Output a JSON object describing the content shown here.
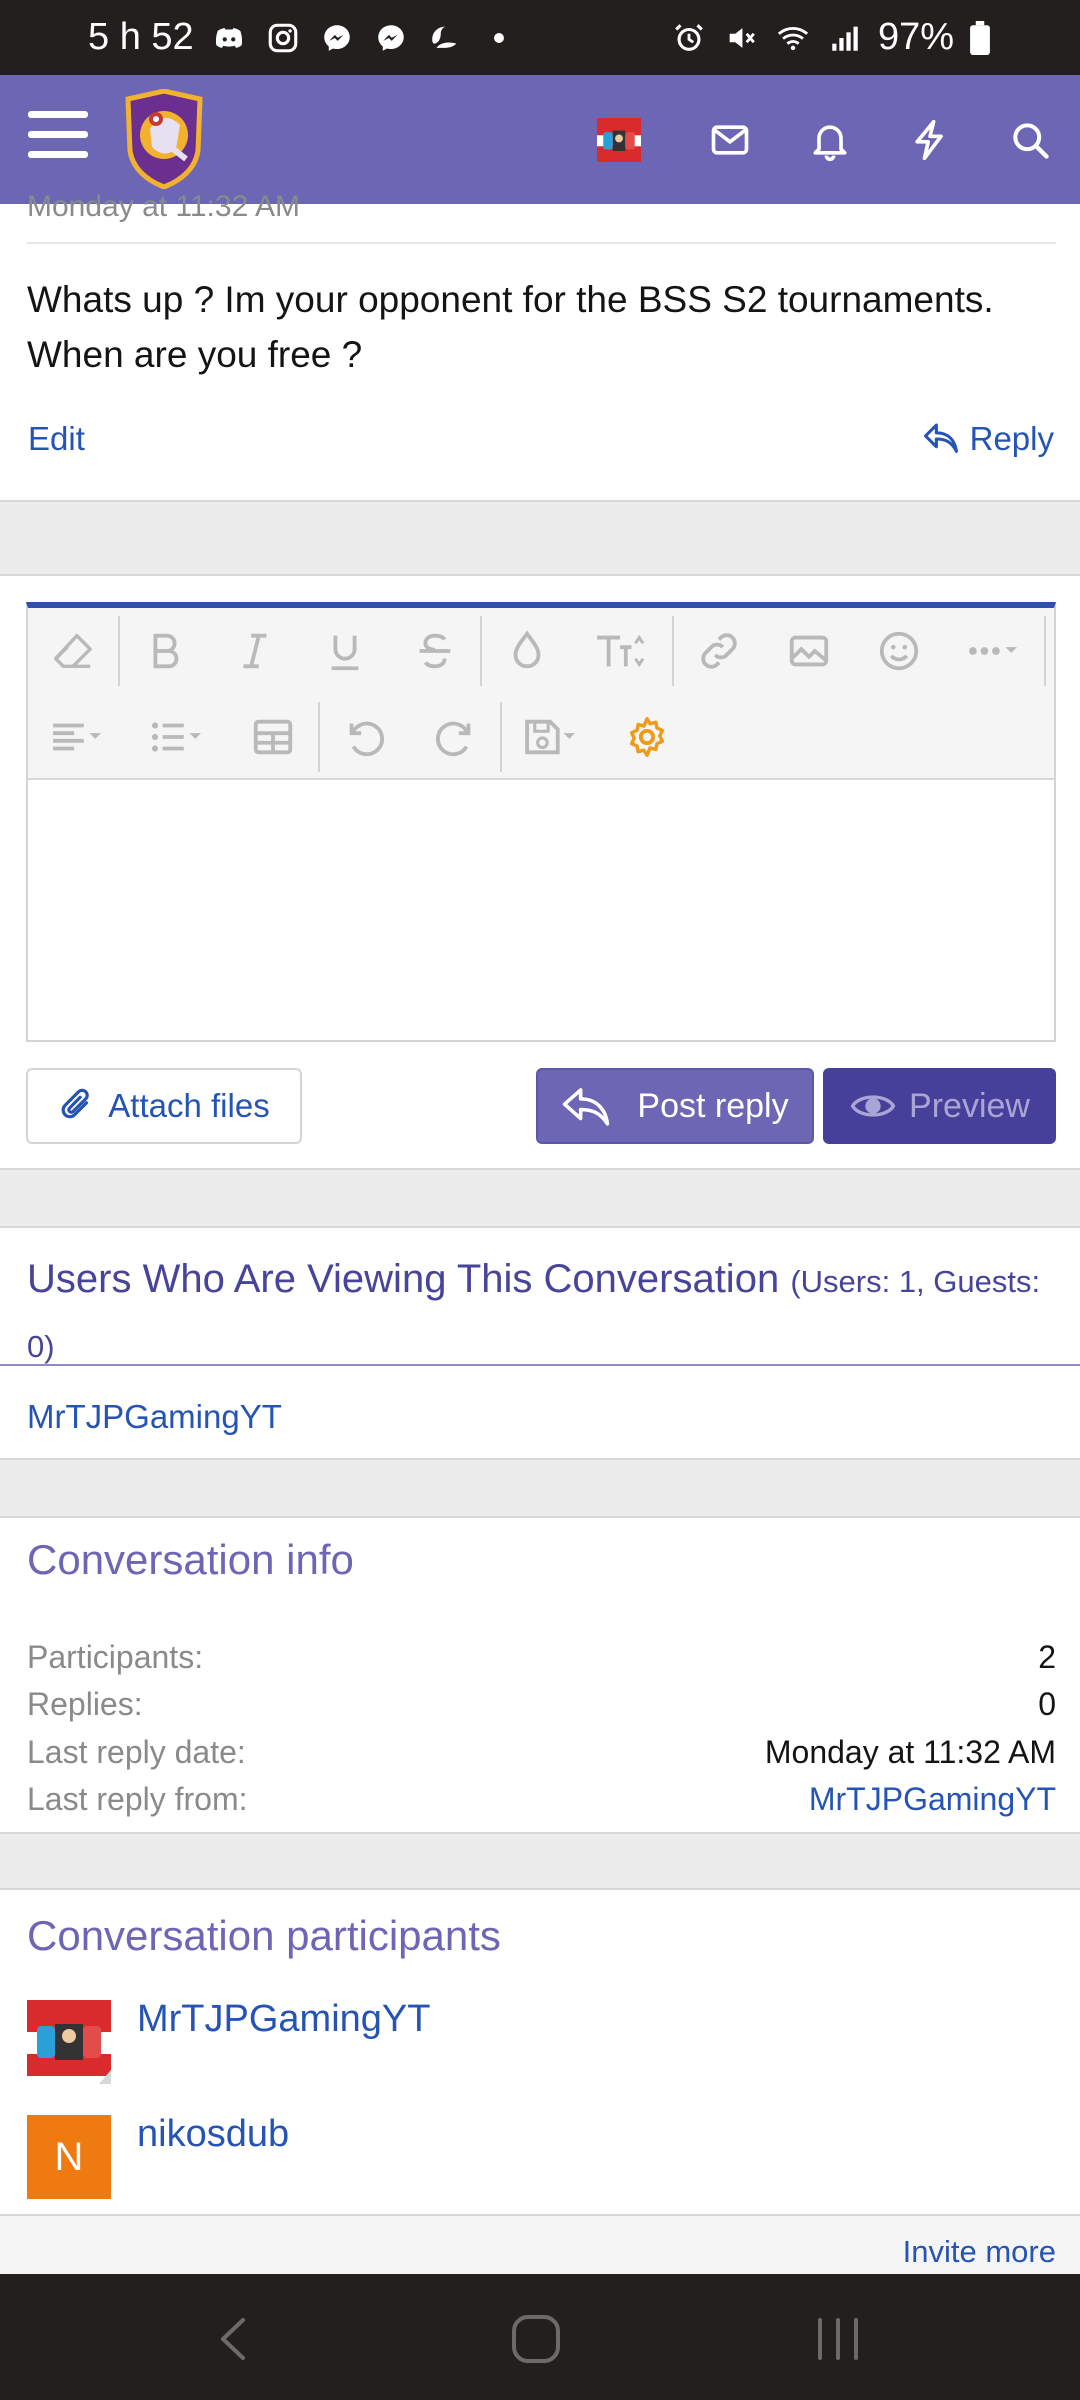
{
  "status_bar": {
    "time": "5 h 52",
    "battery": "97%",
    "left_icons": [
      "discord-icon",
      "instagram-icon",
      "messenger-icon",
      "messenger-icon",
      "sleep-icon",
      "dot-icon"
    ],
    "right_icons": [
      "alarm-icon",
      "mute-icon",
      "wifi-icon",
      "signal-icon",
      "battery-icon"
    ]
  },
  "app_bar": {
    "icons": [
      "menu-icon",
      "site-logo",
      "user-avatar",
      "inbox-icon",
      "bell-icon",
      "bolt-icon",
      "search-icon"
    ],
    "color": "#6c66b5"
  },
  "message": {
    "date": "Monday at 11:32 AM",
    "body": "Whats up ? Im your opponent for the BSS S2 tournaments. When are you free ?",
    "edit_label": "Edit",
    "reply_label": "Reply"
  },
  "editor": {
    "toolbar_row1": [
      "eraser-icon",
      "bold-icon",
      "italic-icon",
      "underline-icon",
      "strikethrough-icon",
      "color-drop-icon",
      "text-size-icon",
      "link-icon",
      "image-icon",
      "smiley-icon",
      "more-icon"
    ],
    "toolbar_row2": [
      "align-icon",
      "list-icon",
      "table-icon",
      "undo-icon",
      "redo-icon",
      "save-draft-icon",
      "settings-gear-icon"
    ],
    "attach_label": "Attach files",
    "post_label": "Post reply",
    "preview_label": "Preview"
  },
  "viewers": {
    "title": "Users Who Are Viewing This Conversation",
    "count": "(Users: 1, Guests: 0)",
    "users": [
      "MrTJPGamingYT"
    ]
  },
  "conversation_info": {
    "title": "Conversation info",
    "rows": [
      {
        "label": "Participants:",
        "value": "2"
      },
      {
        "label": "Replies:",
        "value": "0"
      },
      {
        "label": "Last reply date:",
        "value": "Monday at 11:32 AM"
      },
      {
        "label": "Last reply from:",
        "value": "MrTJPGamingYT"
      }
    ]
  },
  "participants": {
    "title": "Conversation participants",
    "list": [
      {
        "name": "MrTJPGamingYT",
        "avatar": "image"
      },
      {
        "name": "nikosdub",
        "avatar_letter": "N",
        "avatar_color": "#ef7a12"
      }
    ],
    "invite_label": "Invite more"
  },
  "nav_bar": {
    "icons": [
      "back-icon",
      "home-icon",
      "recents-icon"
    ]
  }
}
